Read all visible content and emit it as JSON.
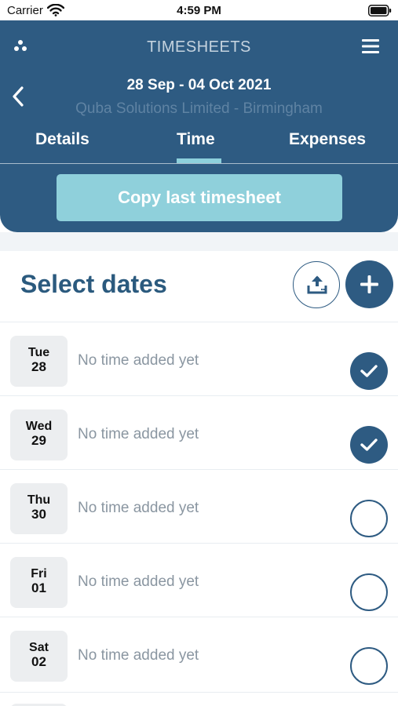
{
  "status_bar": {
    "carrier": "Carrier",
    "time": "4:59 PM"
  },
  "header": {
    "title": "TIMESHEETS",
    "week_range": "28 Sep - 04 Oct 2021",
    "company": "Quba Solutions Limited - Birmingham",
    "tabs": [
      {
        "label": "Details",
        "active": false
      },
      {
        "label": "Time",
        "active": true
      },
      {
        "label": "Expenses",
        "active": false
      }
    ],
    "copy_button_label": "Copy last timesheet"
  },
  "section": {
    "title": "Select dates"
  },
  "days": [
    {
      "dow": "Tue",
      "day": "28",
      "status": "No time added yet",
      "selected": true
    },
    {
      "dow": "Wed",
      "day": "29",
      "status": "No time added yet",
      "selected": true
    },
    {
      "dow": "Thu",
      "day": "30",
      "status": "No time added yet",
      "selected": false
    },
    {
      "dow": "Fri",
      "day": "01",
      "status": "No time added yet",
      "selected": false
    },
    {
      "dow": "Sat",
      "day": "02",
      "status": "No time added yet",
      "selected": false
    }
  ],
  "colors": {
    "primary": "#2e5b82",
    "accent": "#8fd0db",
    "muted_text": "#8a96a1",
    "date_tile": "#eceef0"
  },
  "icons": [
    "wifi-icon",
    "battery-icon",
    "app-logo-icon",
    "menu-icon",
    "back-icon",
    "upload-icon",
    "plus-icon",
    "check-icon"
  ]
}
